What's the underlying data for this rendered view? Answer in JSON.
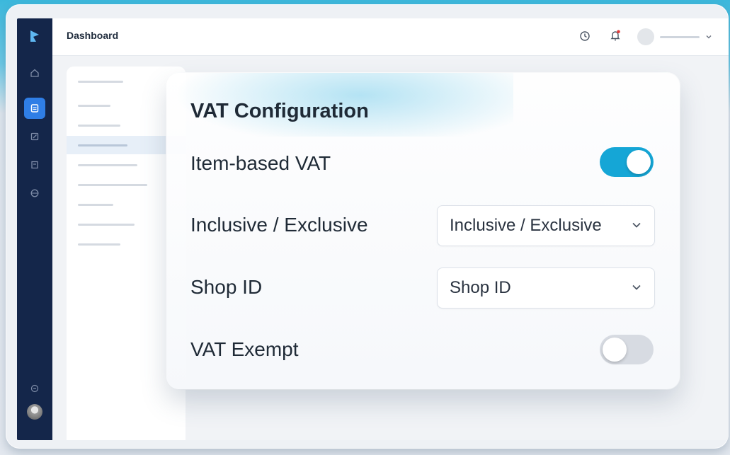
{
  "topbar": {
    "title": "Dashboard"
  },
  "sidebar": {
    "items": [
      {
        "icon": "home-icon",
        "active": false
      },
      {
        "icon": "document-icon",
        "active": true
      },
      {
        "icon": "edit-icon",
        "active": false
      },
      {
        "icon": "receipt-icon",
        "active": false
      },
      {
        "icon": "globe-icon",
        "active": false
      }
    ]
  },
  "vat_card": {
    "title": "VAT Configuration",
    "item_based_vat": {
      "label": "Item-based VAT",
      "enabled": true
    },
    "inclusive_exclusive": {
      "label": "Inclusive / Exclusive",
      "value": "Inclusive / Exclusive"
    },
    "shop_id": {
      "label": "Shop ID",
      "value": "Shop ID"
    },
    "vat_exempt": {
      "label": "VAT Exempt",
      "enabled": false
    }
  },
  "colors": {
    "sidebar_bg": "#14264a",
    "sidebar_active": "#2f7ee6",
    "toggle_on": "#15a6d6",
    "toggle_off": "#d7dbe2",
    "accent_glow": "#3cb8dc"
  }
}
